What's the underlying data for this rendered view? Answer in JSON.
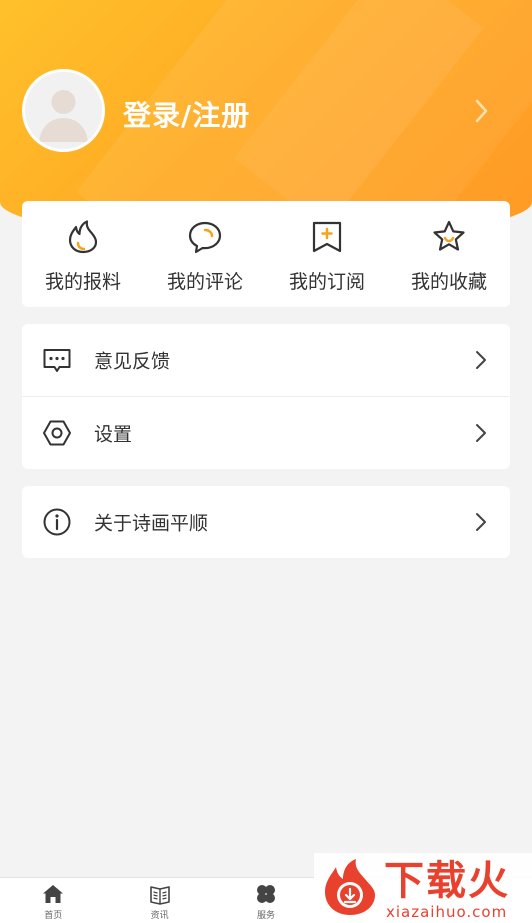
{
  "header": {
    "login_label": "登录/注册",
    "gradient_colors": [
      "#ffc12b",
      "#ff9a26"
    ]
  },
  "quick_actions": [
    {
      "label": "我的报料",
      "icon": "flame-icon"
    },
    {
      "label": "我的评论",
      "icon": "comment-icon"
    },
    {
      "label": "我的订阅",
      "icon": "bookmark-add-icon"
    },
    {
      "label": "我的收藏",
      "icon": "star-icon"
    }
  ],
  "menu": {
    "feedback_label": "意见反馈",
    "settings_label": "设置",
    "about_label": "关于诗画平顺"
  },
  "tabbar": [
    {
      "label": "首页",
      "icon": "home-icon"
    },
    {
      "label": "资讯",
      "icon": "newspaper-icon"
    },
    {
      "label": "服务",
      "icon": "clover-icon"
    }
  ],
  "watermark": {
    "title": "下载火",
    "url": "xiazaihuo.com"
  },
  "colors": {
    "accent": "#f7a21b",
    "icon_dark": "#333333",
    "watermark_red": "#e8412e"
  }
}
